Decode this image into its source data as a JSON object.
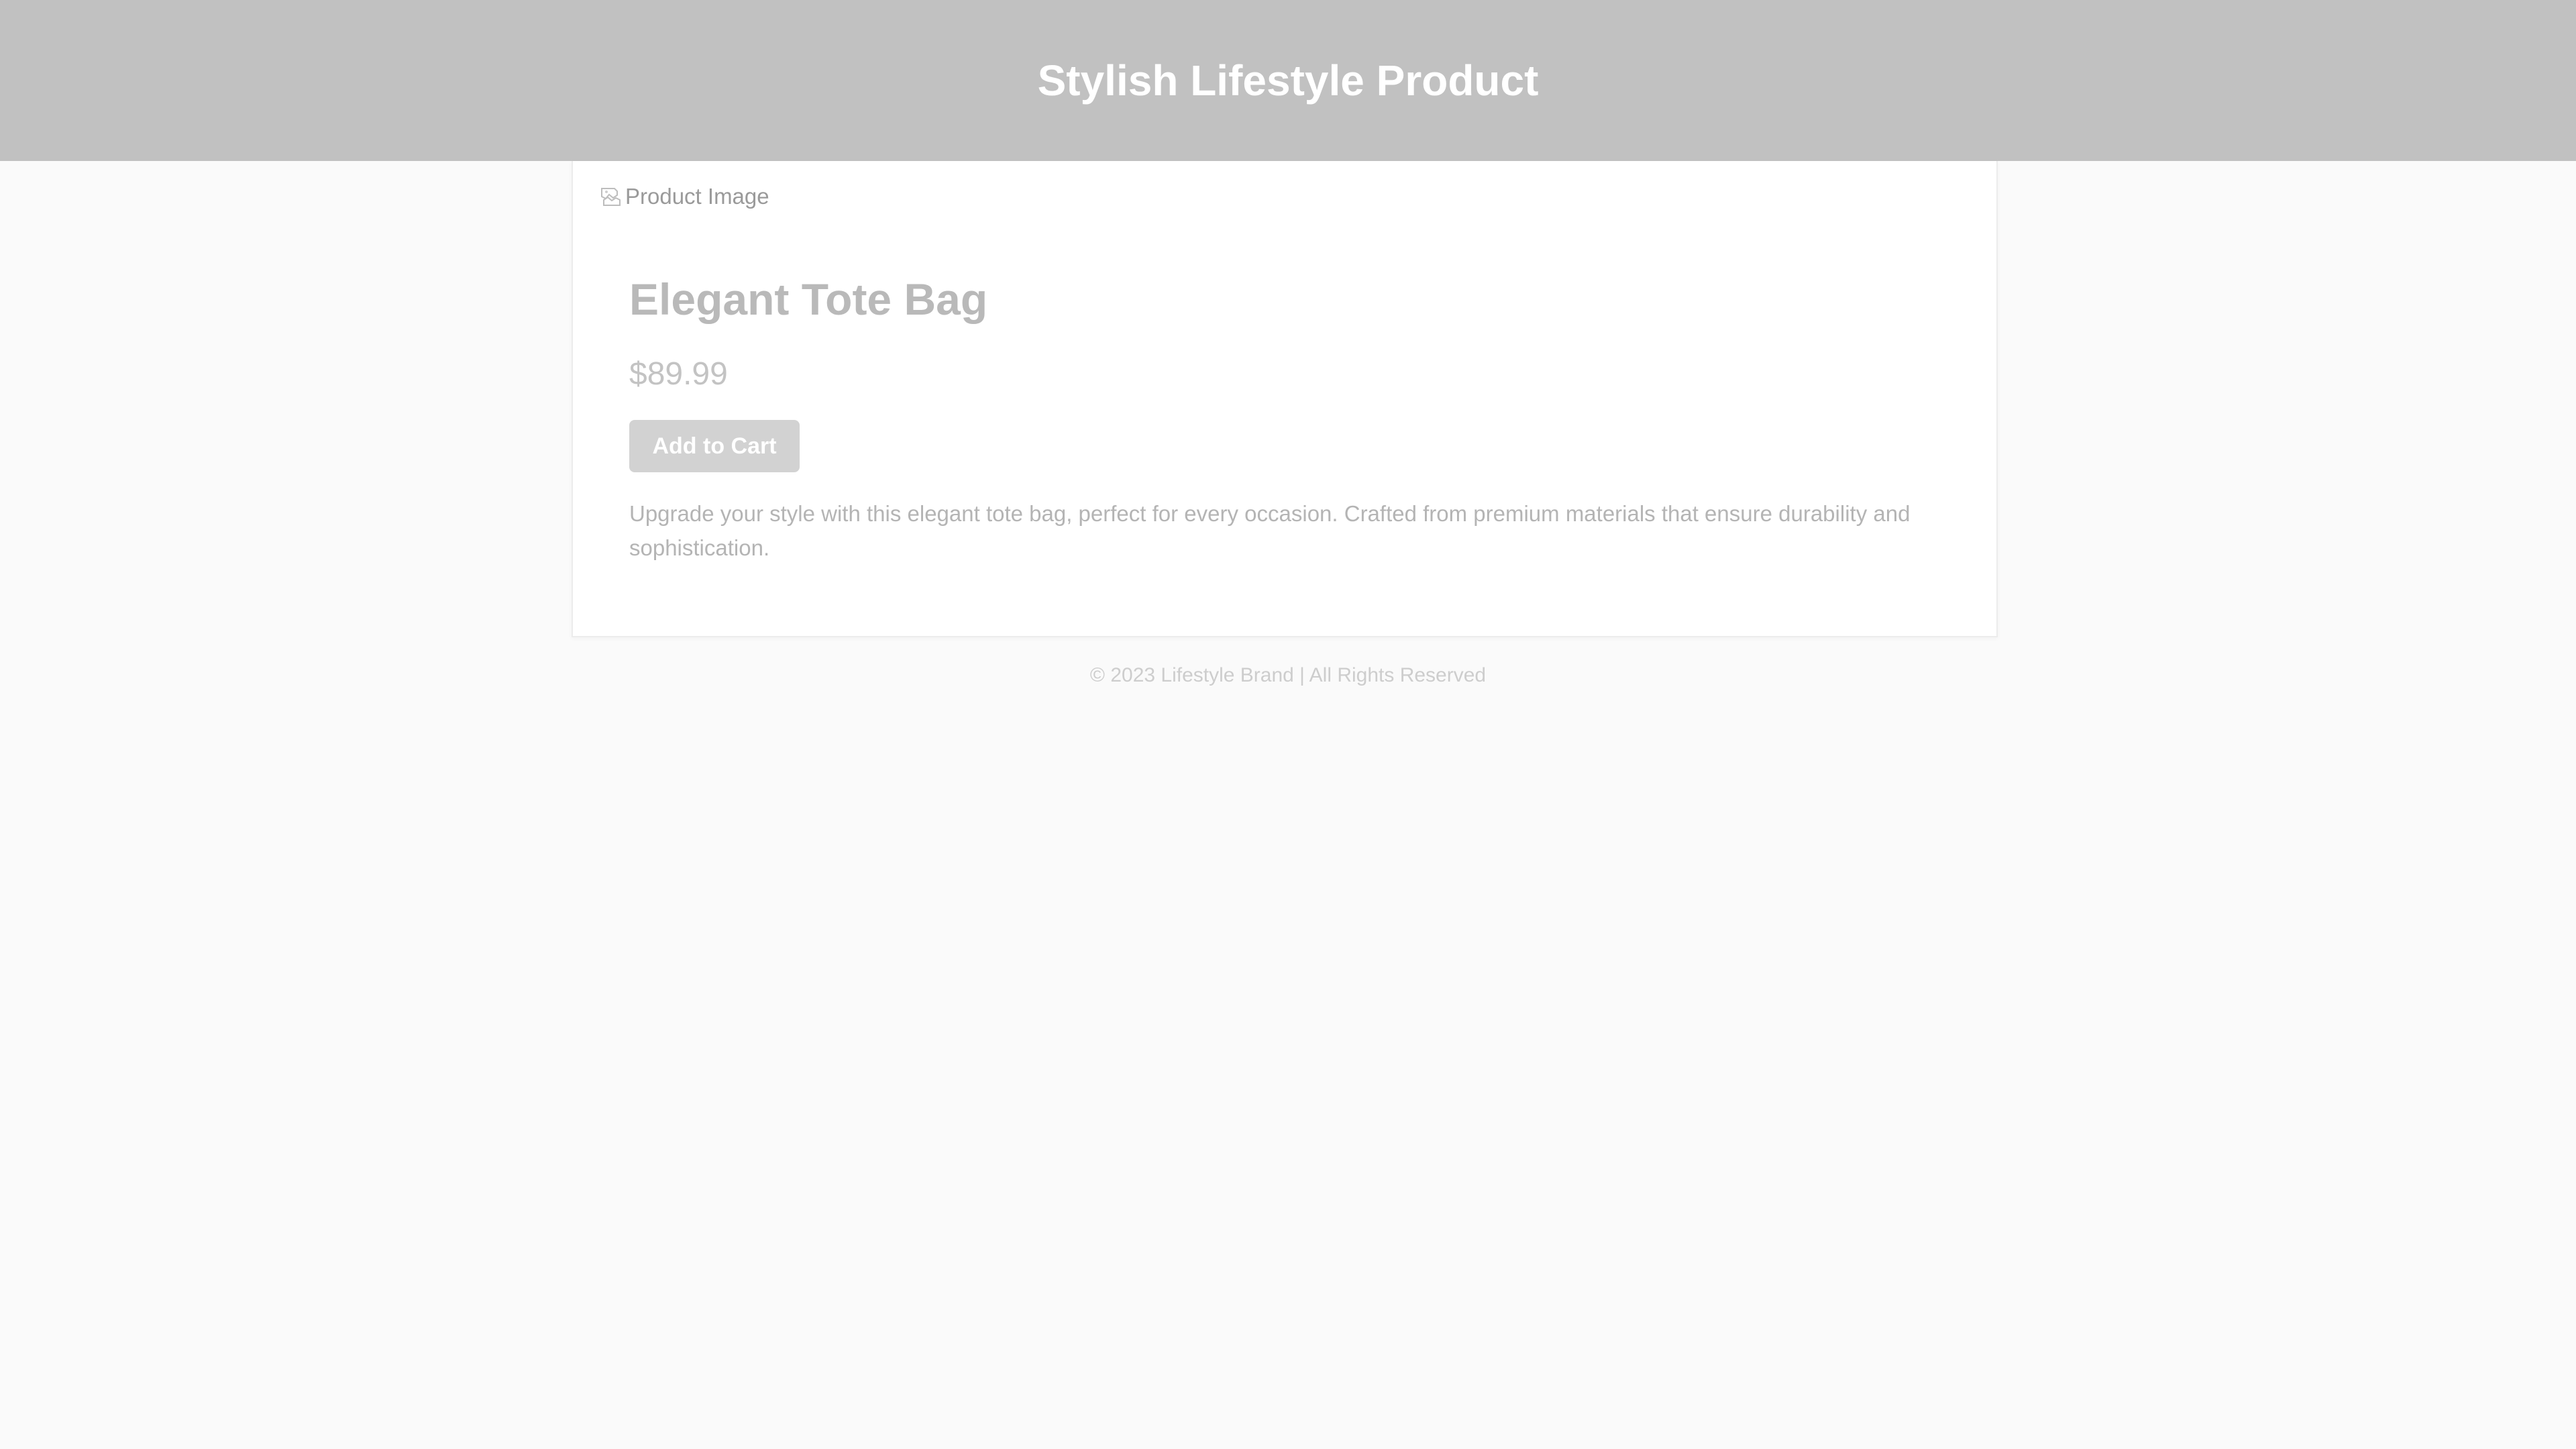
{
  "header": {
    "title": "Stylish Lifestyle Product"
  },
  "product": {
    "image_alt": "Product Image",
    "image_icon": "broken-image-icon",
    "name": "Elegant Tote Bag",
    "price": "$89.99",
    "add_to_cart_label": "Add to Cart",
    "description": "Upgrade your style with this elegant tote bag, perfect for every occasion. Crafted from premium materials that ensure durability and sophistication."
  },
  "footer": {
    "text": "© 2023 Lifestyle Brand | All Rights Reserved"
  },
  "colors": {
    "header_bg": "#c1c1c1",
    "page_bg": "#fafafa",
    "button_bg": "#d2d2d2"
  }
}
